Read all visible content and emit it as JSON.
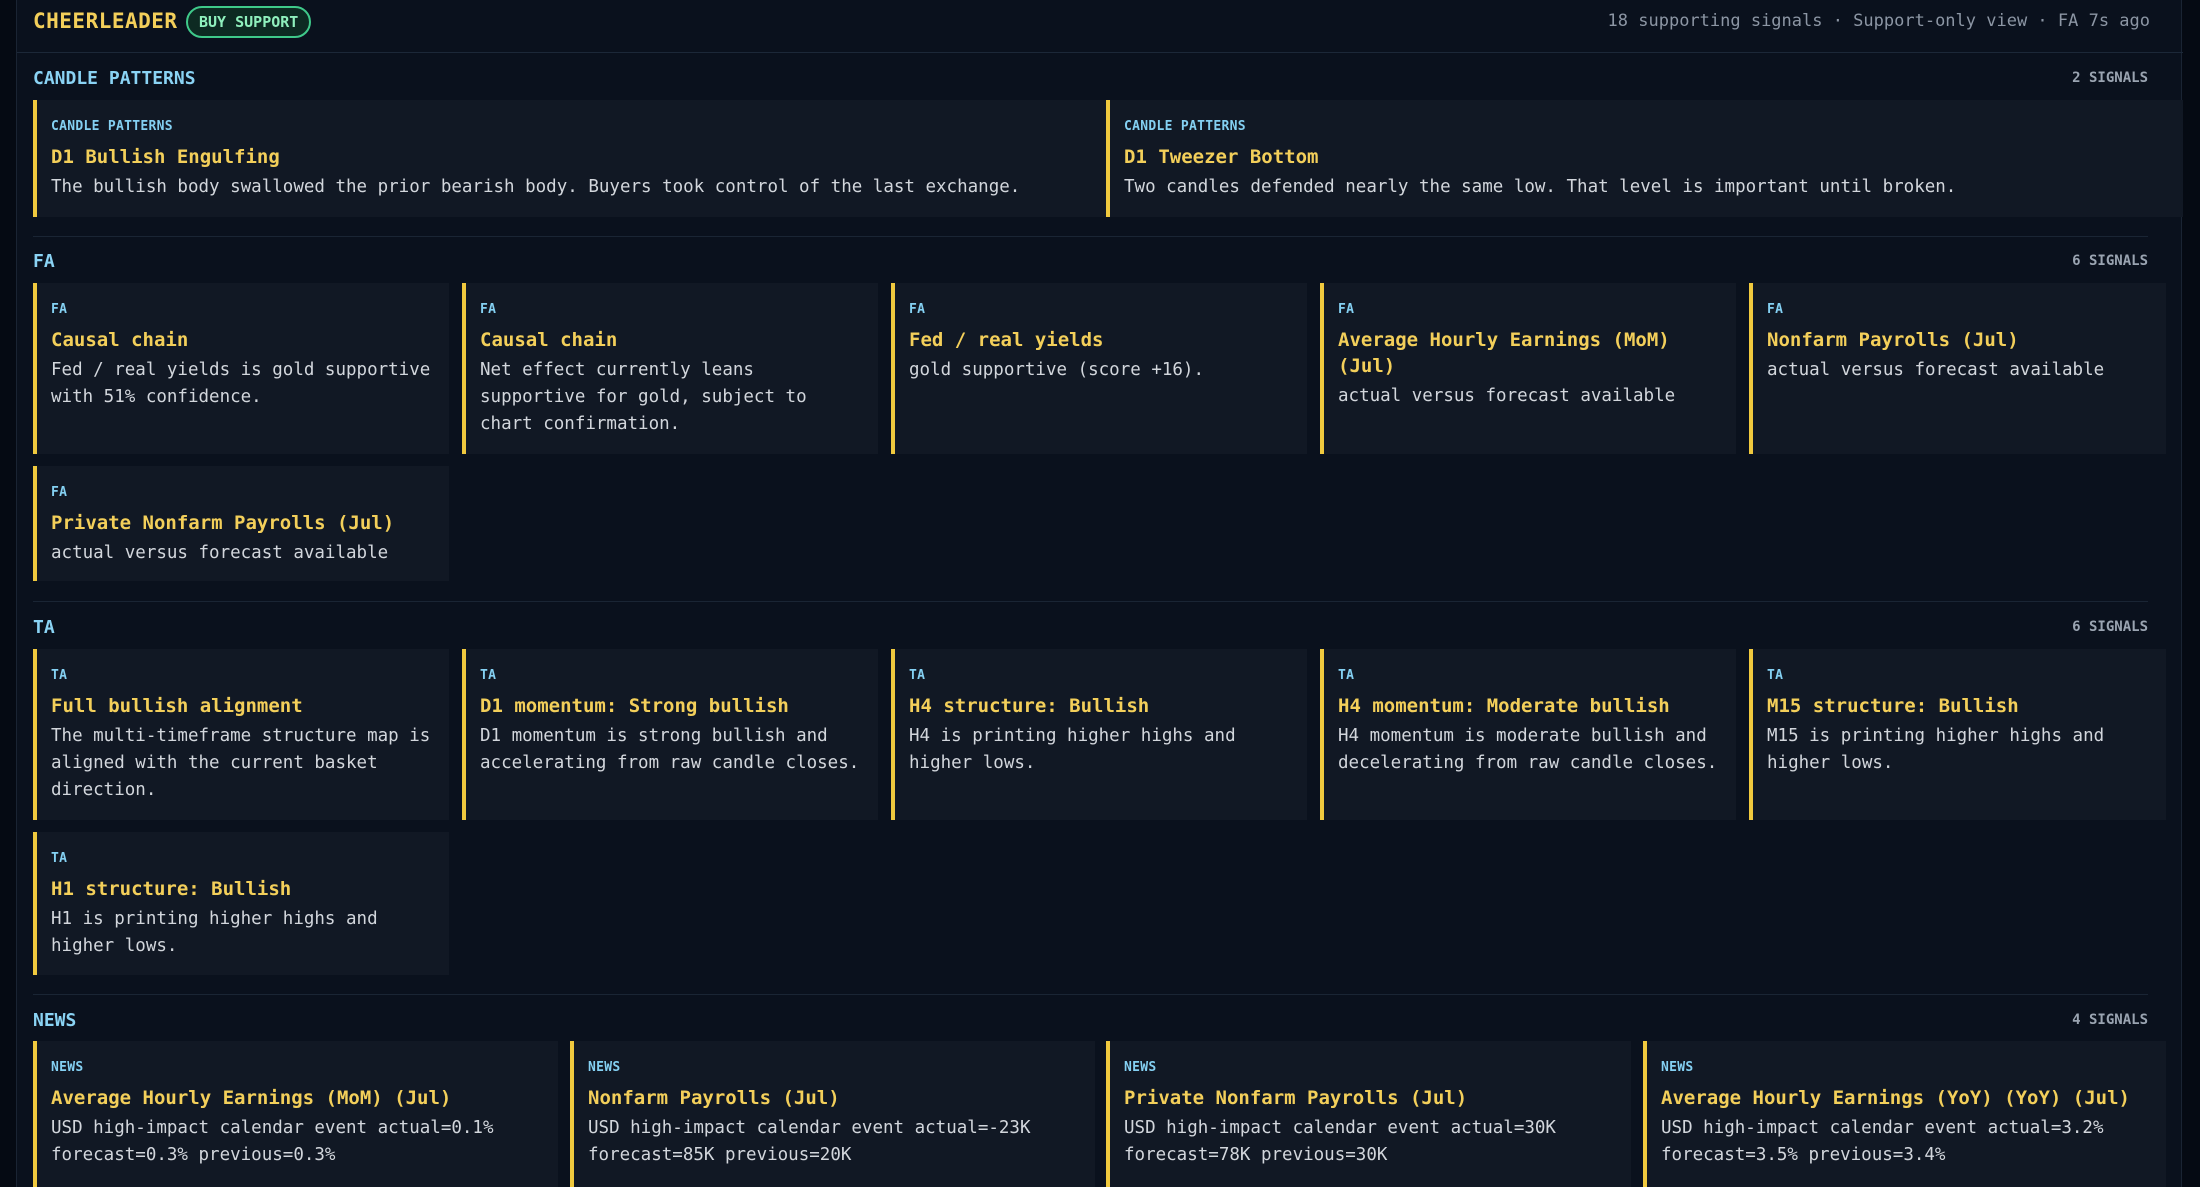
{
  "header": {
    "brand": "CHEERLEADER",
    "badge": "BUY SUPPORT",
    "meta": "18 supporting signals · Support-only view · FA 7s ago"
  },
  "sections": [
    {
      "title": "CANDLE PATTERNS",
      "count": "2 SIGNALS",
      "cards": [
        {
          "tag": "CANDLE PATTERNS",
          "title": "D1 Bullish Engulfing",
          "body": "The bullish body swallowed the prior bearish body. Buyers took control of the last exchange."
        },
        {
          "tag": "CANDLE PATTERNS",
          "title": "D1 Tweezer Bottom",
          "body": "Two candles defended nearly the same low. That level is important until broken."
        }
      ]
    },
    {
      "title": "FA",
      "count": "6 SIGNALS",
      "cards": [
        {
          "tag": "FA",
          "title": "Causal chain",
          "body": "Fed / real yields is gold supportive with 51% confidence."
        },
        {
          "tag": "FA",
          "title": "Causal chain",
          "body": "Net effect currently leans supportive for gold, subject to chart confirmation."
        },
        {
          "tag": "FA",
          "title": "Fed / real yields",
          "body": "gold supportive (score +16)."
        },
        {
          "tag": "FA",
          "title": "Average Hourly Earnings (MoM) (Jul)",
          "body": "actual versus forecast available"
        },
        {
          "tag": "FA",
          "title": "Nonfarm Payrolls (Jul)",
          "body": "actual versus forecast available"
        },
        {
          "tag": "FA",
          "title": "Private Nonfarm Payrolls (Jul)",
          "body": "actual versus forecast available"
        }
      ]
    },
    {
      "title": "TA",
      "count": "6 SIGNALS",
      "cards": [
        {
          "tag": "TA",
          "title": "Full bullish alignment",
          "body": "The multi-timeframe structure map is aligned with the current basket direction."
        },
        {
          "tag": "TA",
          "title": "D1 momentum: Strong bullish",
          "body": "D1 momentum is strong bullish and accelerating from raw candle closes."
        },
        {
          "tag": "TA",
          "title": "H4 structure: Bullish",
          "body": "H4 is printing higher highs and higher lows."
        },
        {
          "tag": "TA",
          "title": "H4 momentum: Moderate bullish",
          "body": "H4 momentum is moderate bullish and decelerating from raw candle closes."
        },
        {
          "tag": "TA",
          "title": "M15 structure: Bullish",
          "body": "M15 is printing higher highs and higher lows."
        },
        {
          "tag": "TA",
          "title": "H1 structure: Bullish",
          "body": "H1 is printing higher highs and higher lows."
        }
      ]
    },
    {
      "title": "NEWS",
      "count": "4 SIGNALS",
      "cards": [
        {
          "tag": "NEWS",
          "title": "Average Hourly Earnings (MoM) (Jul)",
          "body": "USD high-impact calendar event actual=0.1% forecast=0.3% previous=0.3%"
        },
        {
          "tag": "NEWS",
          "title": "Nonfarm Payrolls (Jul)",
          "body": "USD high-impact calendar event actual=-23K forecast=85K previous=20K"
        },
        {
          "tag": "NEWS",
          "title": "Private Nonfarm Payrolls (Jul)",
          "body": "USD high-impact calendar event actual=30K forecast=78K previous=30K"
        },
        {
          "tag": "NEWS",
          "title": "Average Hourly Earnings (YoY) (YoY) (Jul)",
          "body": "USD high-impact calendar event actual=3.2% forecast=3.5% previous=3.4%"
        }
      ]
    }
  ],
  "colors": {
    "accent": "#f0c93e",
    "section_title": "#8ad3f4",
    "badge": "#3fc98a",
    "background": "#0a111d",
    "card": "#111824"
  }
}
